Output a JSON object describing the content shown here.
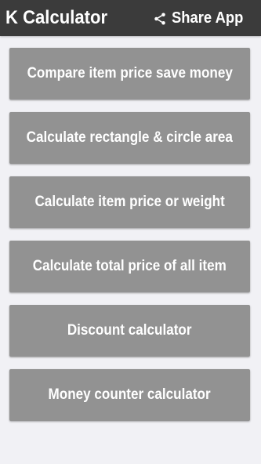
{
  "app_bar": {
    "title": "K Calculator",
    "share_label": "Share App",
    "share_icon": "share-icon",
    "background_color": "#3b3b3b"
  },
  "menu": {
    "button_color": "#929292",
    "items": [
      {
        "label": "Compare item price save money"
      },
      {
        "label": "Calculate rectangle & circle area"
      },
      {
        "label": "Calculate item price or weight"
      },
      {
        "label": "Calculate total price of all item"
      },
      {
        "label": "Discount calculator"
      },
      {
        "label": "Money counter calculator"
      }
    ]
  }
}
